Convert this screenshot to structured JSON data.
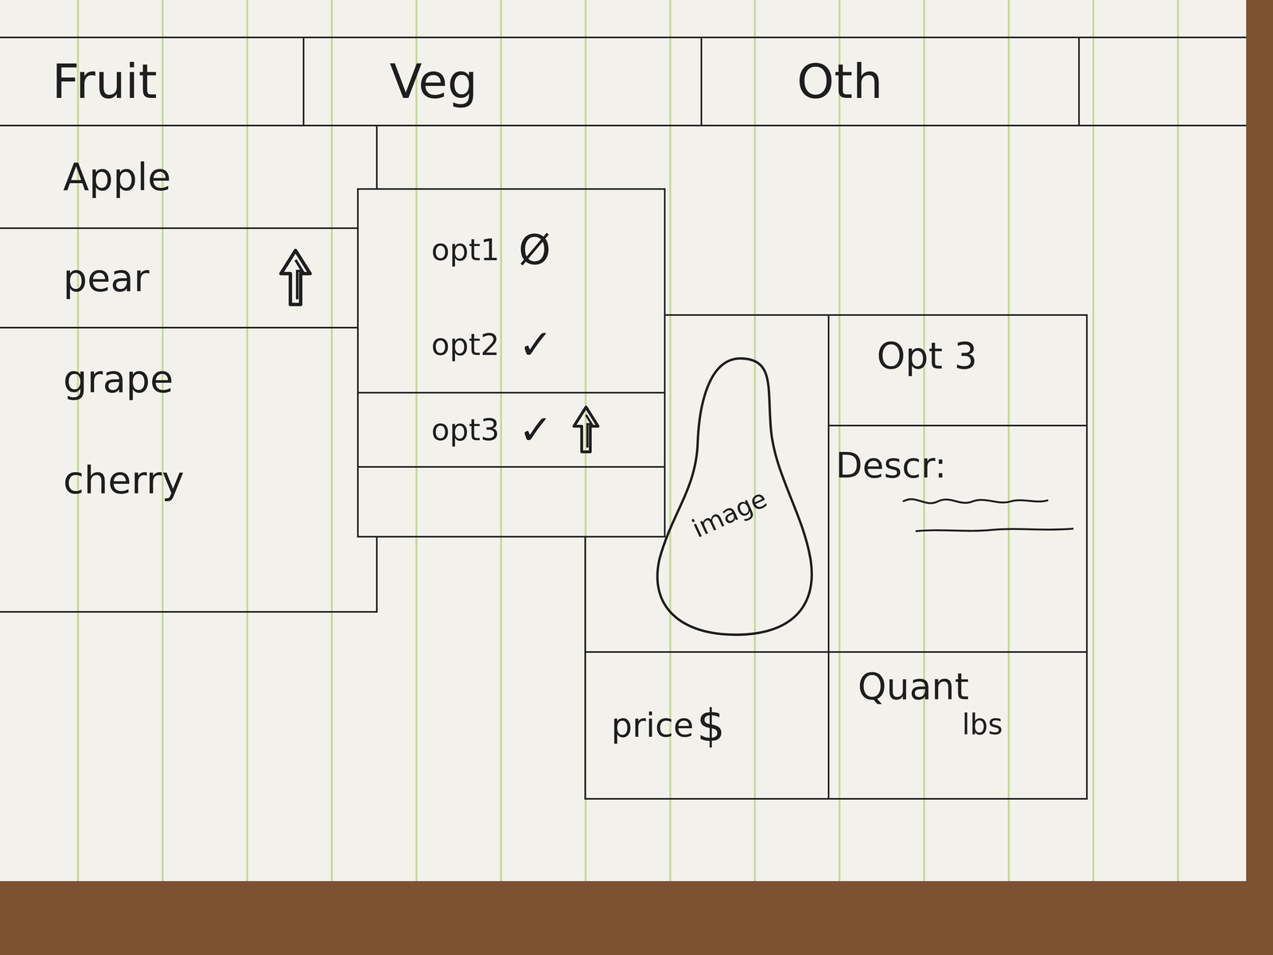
{
  "tabs": [
    {
      "label": "Fruit"
    },
    {
      "label": "Veg"
    },
    {
      "label": "Oth"
    }
  ],
  "fruits": [
    {
      "label": "Apple",
      "hovered": false
    },
    {
      "label": "pear",
      "hovered": true
    },
    {
      "label": "grape",
      "hovered": false
    },
    {
      "label": "cherry",
      "hovered": false
    }
  ],
  "options": [
    {
      "label": "opt1",
      "mark": "Ø",
      "checked": false,
      "hovered": false
    },
    {
      "label": "opt2",
      "mark": "✓",
      "checked": true,
      "hovered": false
    },
    {
      "label": "opt3",
      "mark": "✓",
      "checked": true,
      "hovered": true
    }
  ],
  "detail": {
    "image_label": "image",
    "title": "Opt 3",
    "description_label": "Descr:",
    "price_label": "price",
    "price_unit": "$",
    "quantity_label": "Quant",
    "quantity_unit": "lbs"
  }
}
